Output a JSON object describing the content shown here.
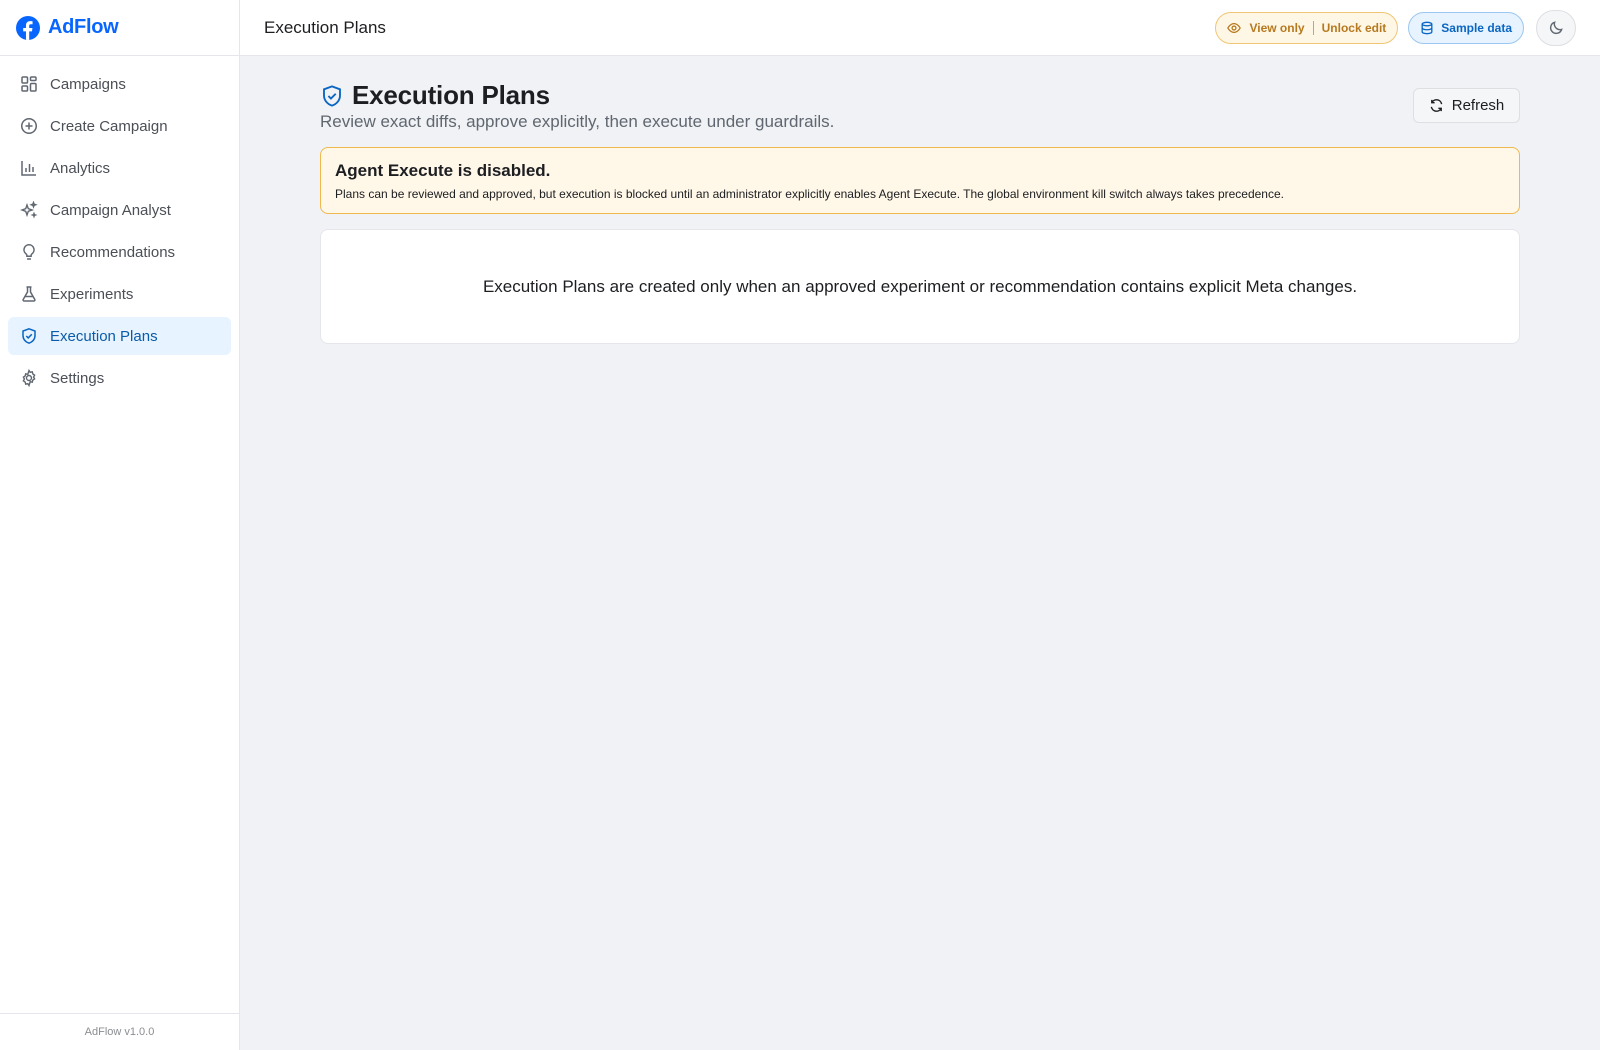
{
  "app": {
    "name": "AdFlow",
    "version": "AdFlow v1.0.0",
    "brand_color": "#0866ff"
  },
  "sidebar": {
    "items": [
      {
        "label": "Campaigns",
        "icon": "grid-icon",
        "active": false
      },
      {
        "label": "Create Campaign",
        "icon": "plus-circle-icon",
        "active": false
      },
      {
        "label": "Analytics",
        "icon": "bar-chart-icon",
        "active": false
      },
      {
        "label": "Campaign Analyst",
        "icon": "sparkles-icon",
        "active": false
      },
      {
        "label": "Recommendations",
        "icon": "lightbulb-icon",
        "active": false
      },
      {
        "label": "Experiments",
        "icon": "flask-icon",
        "active": false
      },
      {
        "label": "Execution Plans",
        "icon": "shield-check-icon",
        "active": true
      },
      {
        "label": "Settings",
        "icon": "gear-icon",
        "active": false
      }
    ]
  },
  "topbar": {
    "title": "Execution Plans",
    "view_only_label": "View only",
    "unlock_label": "Unlock edit",
    "sample_data_label": "Sample data",
    "theme_icon": "moon-icon"
  },
  "page": {
    "title": "Execution Plans",
    "subtitle": "Review exact diffs, approve explicitly, then execute under guardrails.",
    "refresh_label": "Refresh"
  },
  "alert": {
    "title": "Agent Execute is disabled.",
    "body": "Plans can be reviewed and approved, but execution is blocked until an administrator explicitly enables Agent Execute. The global environment kill switch always takes precedence."
  },
  "empty_state": {
    "message": "Execution Plans are created only when an approved experiment or recommendation contains explicit Meta changes."
  },
  "colors": {
    "active_nav_bg": "#e7f3ff",
    "warning_border": "#f0b84d",
    "warning_bg": "#fff7e8",
    "accent": "#0a66c2"
  }
}
